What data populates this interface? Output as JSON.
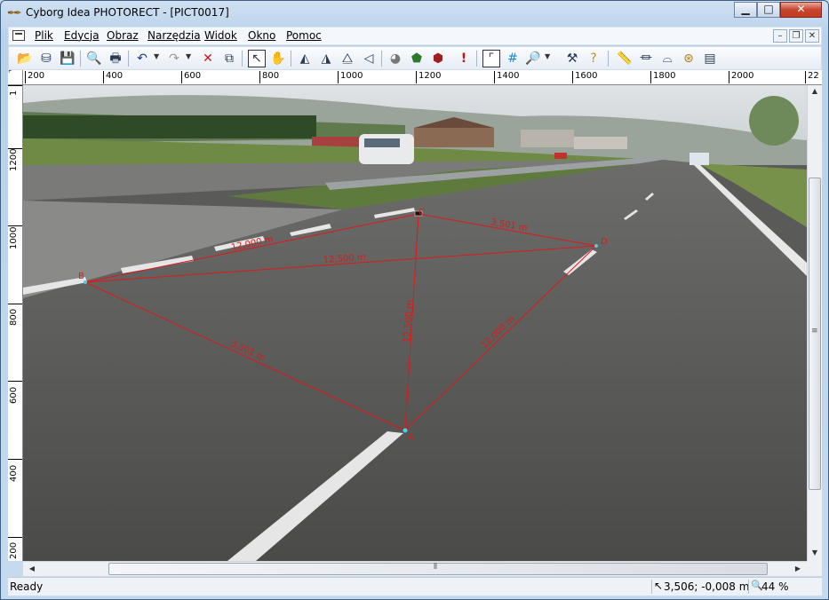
{
  "window": {
    "title": "Cyborg Idea PHOTORECT - [PICT0017]",
    "app_icon": "cyborg-app-icon",
    "buttons": {
      "minimize": "▁",
      "maximize": "□",
      "close": "✕"
    }
  },
  "menu": {
    "items": [
      "Plik",
      "Edycja",
      "Obraz",
      "Narzędzia",
      "Widok",
      "Okno",
      "Pomoc"
    ],
    "mdi_buttons": {
      "minimize": "–",
      "restore": "❐",
      "close": "✕"
    }
  },
  "toolbar": {
    "icons": [
      "open-icon",
      "scan-icon",
      "save-icon",
      "print-preview-icon",
      "print-icon",
      "undo-icon",
      "redo-icon",
      "delete-icon",
      "properties-icon",
      "select-arrow-icon",
      "hand-pan-icon",
      "flip-left-icon",
      "flip-right-icon",
      "mirror-icon",
      "align-icon",
      "pie-icon",
      "shape-icon",
      "shape-delete-icon",
      "warning-icon",
      "frame-select-icon",
      "grid-icon",
      "zoom-icon",
      "tools-icon",
      "help-icon",
      "measure-ruler-icon",
      "level-icon",
      "arc-icon",
      "circle-icon",
      "stairs-icon"
    ]
  },
  "rulers": {
    "horizontal_labels": [
      "200",
      "400",
      "600",
      "800",
      "1000",
      "1200",
      "1400",
      "1600",
      "1800",
      "2000",
      "22"
    ],
    "vertical_labels": [
      "1",
      "1200",
      "1000",
      "800",
      "600",
      "400",
      "200"
    ]
  },
  "measurement": {
    "points": {
      "A": "A",
      "B": "B",
      "C": "C",
      "D": "D"
    },
    "dimensions": {
      "BC": "12,000 m",
      "CD": "3,501 m",
      "BD": "12,500 m",
      "AC": "12,500 m",
      "AD": "12,000 m",
      "AB": "3,501 m"
    }
  },
  "status": {
    "ready": "Ready",
    "coords": "3,506; -0,008 m",
    "zoom": "44 %"
  },
  "colors": {
    "measure_line": "#e01818",
    "titlebar": "#b9d1ea"
  }
}
